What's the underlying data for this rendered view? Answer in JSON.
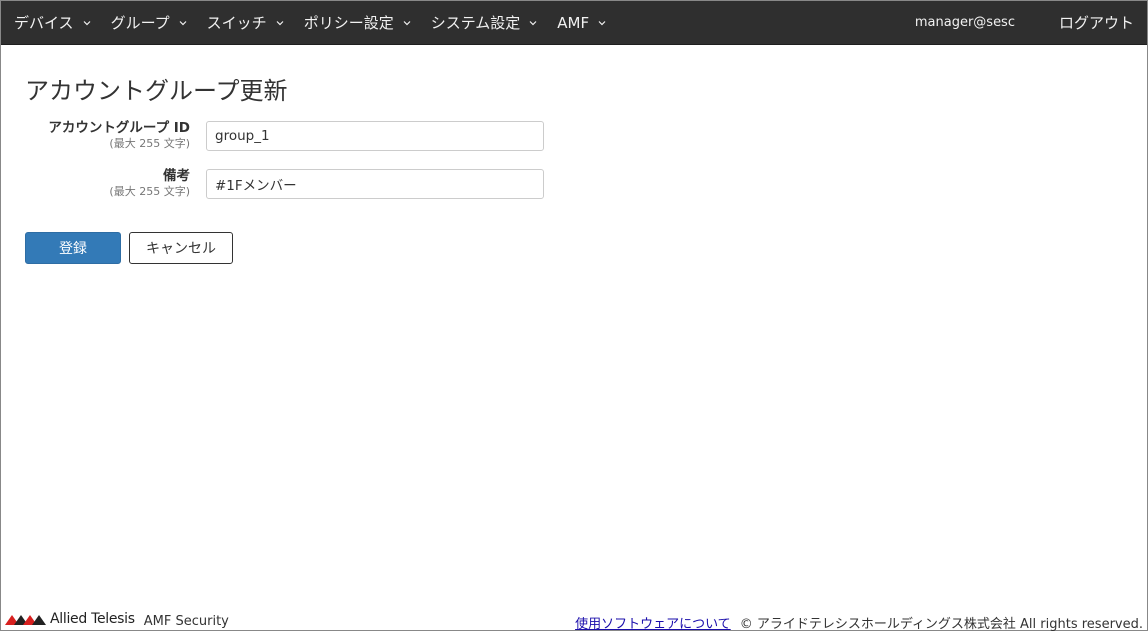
{
  "navbar": {
    "items": [
      {
        "label": "デバイス"
      },
      {
        "label": "グループ"
      },
      {
        "label": "スイッチ"
      },
      {
        "label": "ポリシー設定"
      },
      {
        "label": "システム設定"
      },
      {
        "label": "AMF"
      }
    ],
    "user": "manager@sesc",
    "logout": "ログアウト",
    "caret_icon": "chevron-down-icon"
  },
  "page": {
    "title": "アカウントグループ更新"
  },
  "form": {
    "group_id": {
      "label": "アカウントグループ ID",
      "hint": "(最大 255 文字)",
      "value": "group_1"
    },
    "note": {
      "label": "備考",
      "hint": "(最大 255 文字)",
      "value": "#1Fメンバー"
    }
  },
  "buttons": {
    "submit": "登録",
    "cancel": "キャンセル"
  },
  "footer": {
    "brand": "Allied Telesis",
    "product": "AMF Security",
    "link": "使用ソフトウェアについて",
    "copyright": "© アライドテレシスホールディングス株式会社 All rights reserved."
  },
  "colors": {
    "navbar_bg": "#2f2f2f",
    "primary": "#337ab7",
    "link": "#1a0dab"
  }
}
